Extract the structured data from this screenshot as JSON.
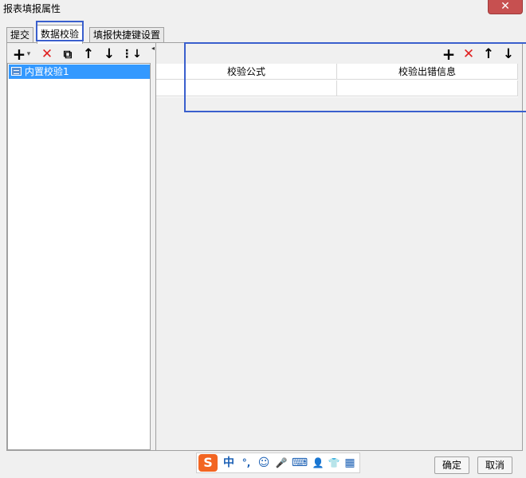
{
  "window": {
    "title": "报表填报属性",
    "close_glyph": "✕"
  },
  "tabs": [
    {
      "label": "提交"
    },
    {
      "label": "数据校验"
    },
    {
      "label": "填报快捷键设置"
    }
  ],
  "left_toolbar": {
    "add_glyph": "+",
    "add_dropdown_glyph": "▾",
    "delete_glyph": "✕",
    "copy_glyph": "⧉",
    "up_glyph": "↑",
    "down_glyph": "↓",
    "bottom_glyph": "⋮↓"
  },
  "tree": {
    "items": [
      {
        "label": "内置校验1"
      }
    ]
  },
  "splitter": {
    "arrow_glyph": "◂"
  },
  "right_toolbar": {
    "add_glyph": "+",
    "delete_glyph": "✕",
    "up_glyph": "↑",
    "down_glyph": "↓"
  },
  "grid": {
    "columns": [
      {
        "label": "校验公式"
      },
      {
        "label": "校验出错信息"
      }
    ],
    "rows": [
      [
        "",
        ""
      ]
    ]
  },
  "ime": {
    "logo": "S",
    "items": [
      "中",
      "°,",
      "☺",
      "🎤",
      "⌨",
      "👤",
      "👕",
      "▦"
    ]
  },
  "buttons": {
    "ok": "确定",
    "cancel": "取消"
  },
  "colors": {
    "selection": "#3399ff",
    "delete_red": "#e02020",
    "annotation_blue": "#3a5fcd",
    "ime_orange": "#f26522"
  }
}
